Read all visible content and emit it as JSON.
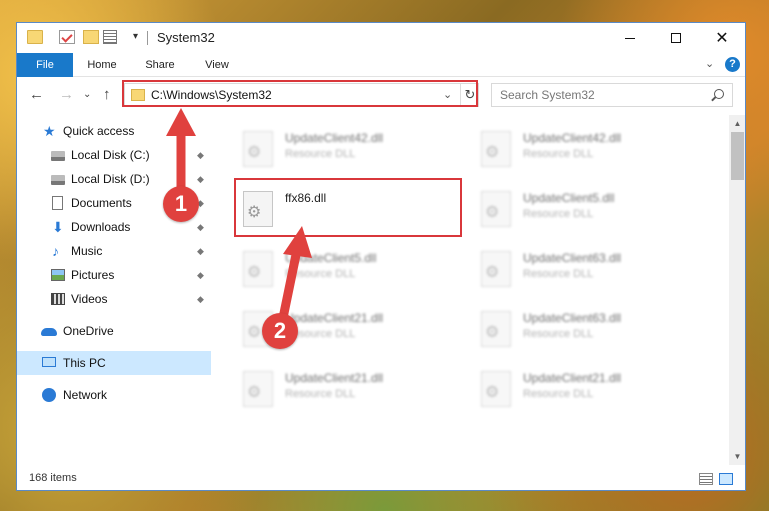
{
  "window": {
    "title": "System32"
  },
  "titlebar": {
    "dropdown_glyph": "▾",
    "min": "",
    "max": "",
    "close": "✕"
  },
  "ribbon": {
    "tabs": [
      "File",
      "Home",
      "Share",
      "View"
    ],
    "collapse_glyph": "⌄",
    "help_glyph": "?"
  },
  "nav": {
    "back": "←",
    "forward": "→",
    "recent": "⌄",
    "up": "↑"
  },
  "address": {
    "path": "C:\\Windows\\System32",
    "dropdown": "⌄",
    "refresh": "↻"
  },
  "search": {
    "placeholder": "Search System32"
  },
  "sidebar": {
    "items": [
      {
        "label": "Quick access",
        "icon": "star-icon"
      },
      {
        "label": "Local Disk (C:)",
        "icon": "disk-icon",
        "pinned": true
      },
      {
        "label": "Local Disk (D:)",
        "icon": "disk-icon",
        "pinned": true
      },
      {
        "label": "Documents",
        "icon": "documents-icon",
        "pinned": true
      },
      {
        "label": "Downloads",
        "icon": "downloads-icon",
        "pinned": true
      },
      {
        "label": "Music",
        "icon": "music-icon",
        "pinned": true
      },
      {
        "label": "Pictures",
        "icon": "pictures-icon",
        "pinned": true
      },
      {
        "label": "Videos",
        "icon": "videos-icon",
        "pinned": true
      },
      {
        "label": "OneDrive",
        "icon": "onedrive-icon"
      },
      {
        "label": "This PC",
        "icon": "pc-icon",
        "selected": true
      },
      {
        "label": "Network",
        "icon": "network-icon"
      }
    ],
    "pin_glyph": "📌"
  },
  "files": [
    {
      "name": "UpdateClient42.dll",
      "type": "Resource DLL"
    },
    {
      "name": "UpdateClient42.dll",
      "type": "Resource DLL"
    },
    {
      "name": "ffx86.dll",
      "type": ""
    },
    {
      "name": "UpdateClient5.dll",
      "type": "Resource DLL"
    },
    {
      "name": "UpdateClient5.dll",
      "type": "Resource DLL"
    },
    {
      "name": "UpdateClient63.dll",
      "type": "Resource DLL"
    },
    {
      "name": "UpdateClient21.dll",
      "type": "Resource DLL"
    },
    {
      "name": "UpdateClient63.dll",
      "type": "Resource DLL"
    },
    {
      "name": "UpdateClient21.dll",
      "type": "Resource DLL"
    },
    {
      "name": "UpdateClient21.dll",
      "type": "Resource DLL"
    }
  ],
  "status": {
    "count": "168 items"
  },
  "scrollbar": {
    "up": "▲",
    "down": "▼"
  },
  "callouts": [
    "1",
    "2"
  ],
  "colors": {
    "accent": "#1979ca",
    "highlight": "#d9373b",
    "callout": "#e0413e",
    "selection": "#cce8ff"
  }
}
